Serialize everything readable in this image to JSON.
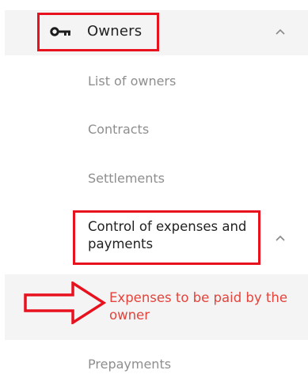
{
  "menu": {
    "owners": {
      "label": "Owners",
      "icon": "key-icon",
      "expand_icon": "chevron-up-icon"
    },
    "subitems": [
      {
        "label": "List of owners"
      },
      {
        "label": "Contracts"
      },
      {
        "label": "Settlements"
      }
    ],
    "control": {
      "label": "Control of expenses and payments",
      "expand_icon": "chevron-up-icon"
    },
    "active_item": {
      "label": "Expenses to be paid by the owner"
    },
    "last_item": {
      "label": "Prepayments"
    }
  },
  "colors": {
    "highlight_border": "#e8121f",
    "active_text": "#e4443c",
    "row_bg": "#f4f4f4",
    "muted_text": "#8e8e8e"
  }
}
